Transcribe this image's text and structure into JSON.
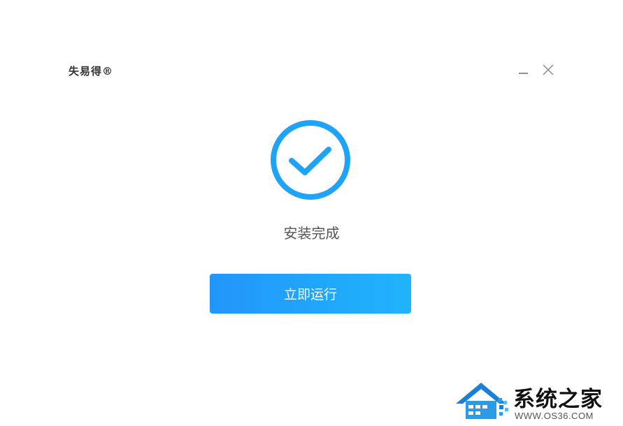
{
  "window": {
    "title": "失易得®"
  },
  "main": {
    "status_text": "安装完成",
    "run_button_label": "立即运行"
  },
  "colors": {
    "accent": "#1fa3f7",
    "button_gradient_start": "#2196fa",
    "button_gradient_end": "#20b4fb",
    "status_text": "#555555"
  },
  "icons": {
    "minimize": "minimize-icon",
    "close": "close-icon",
    "success": "checkmark-circle-icon",
    "watermark_logo": "house-logo-icon"
  },
  "watermark": {
    "name": "系统之家",
    "url": "WWW.OS36.COM"
  }
}
